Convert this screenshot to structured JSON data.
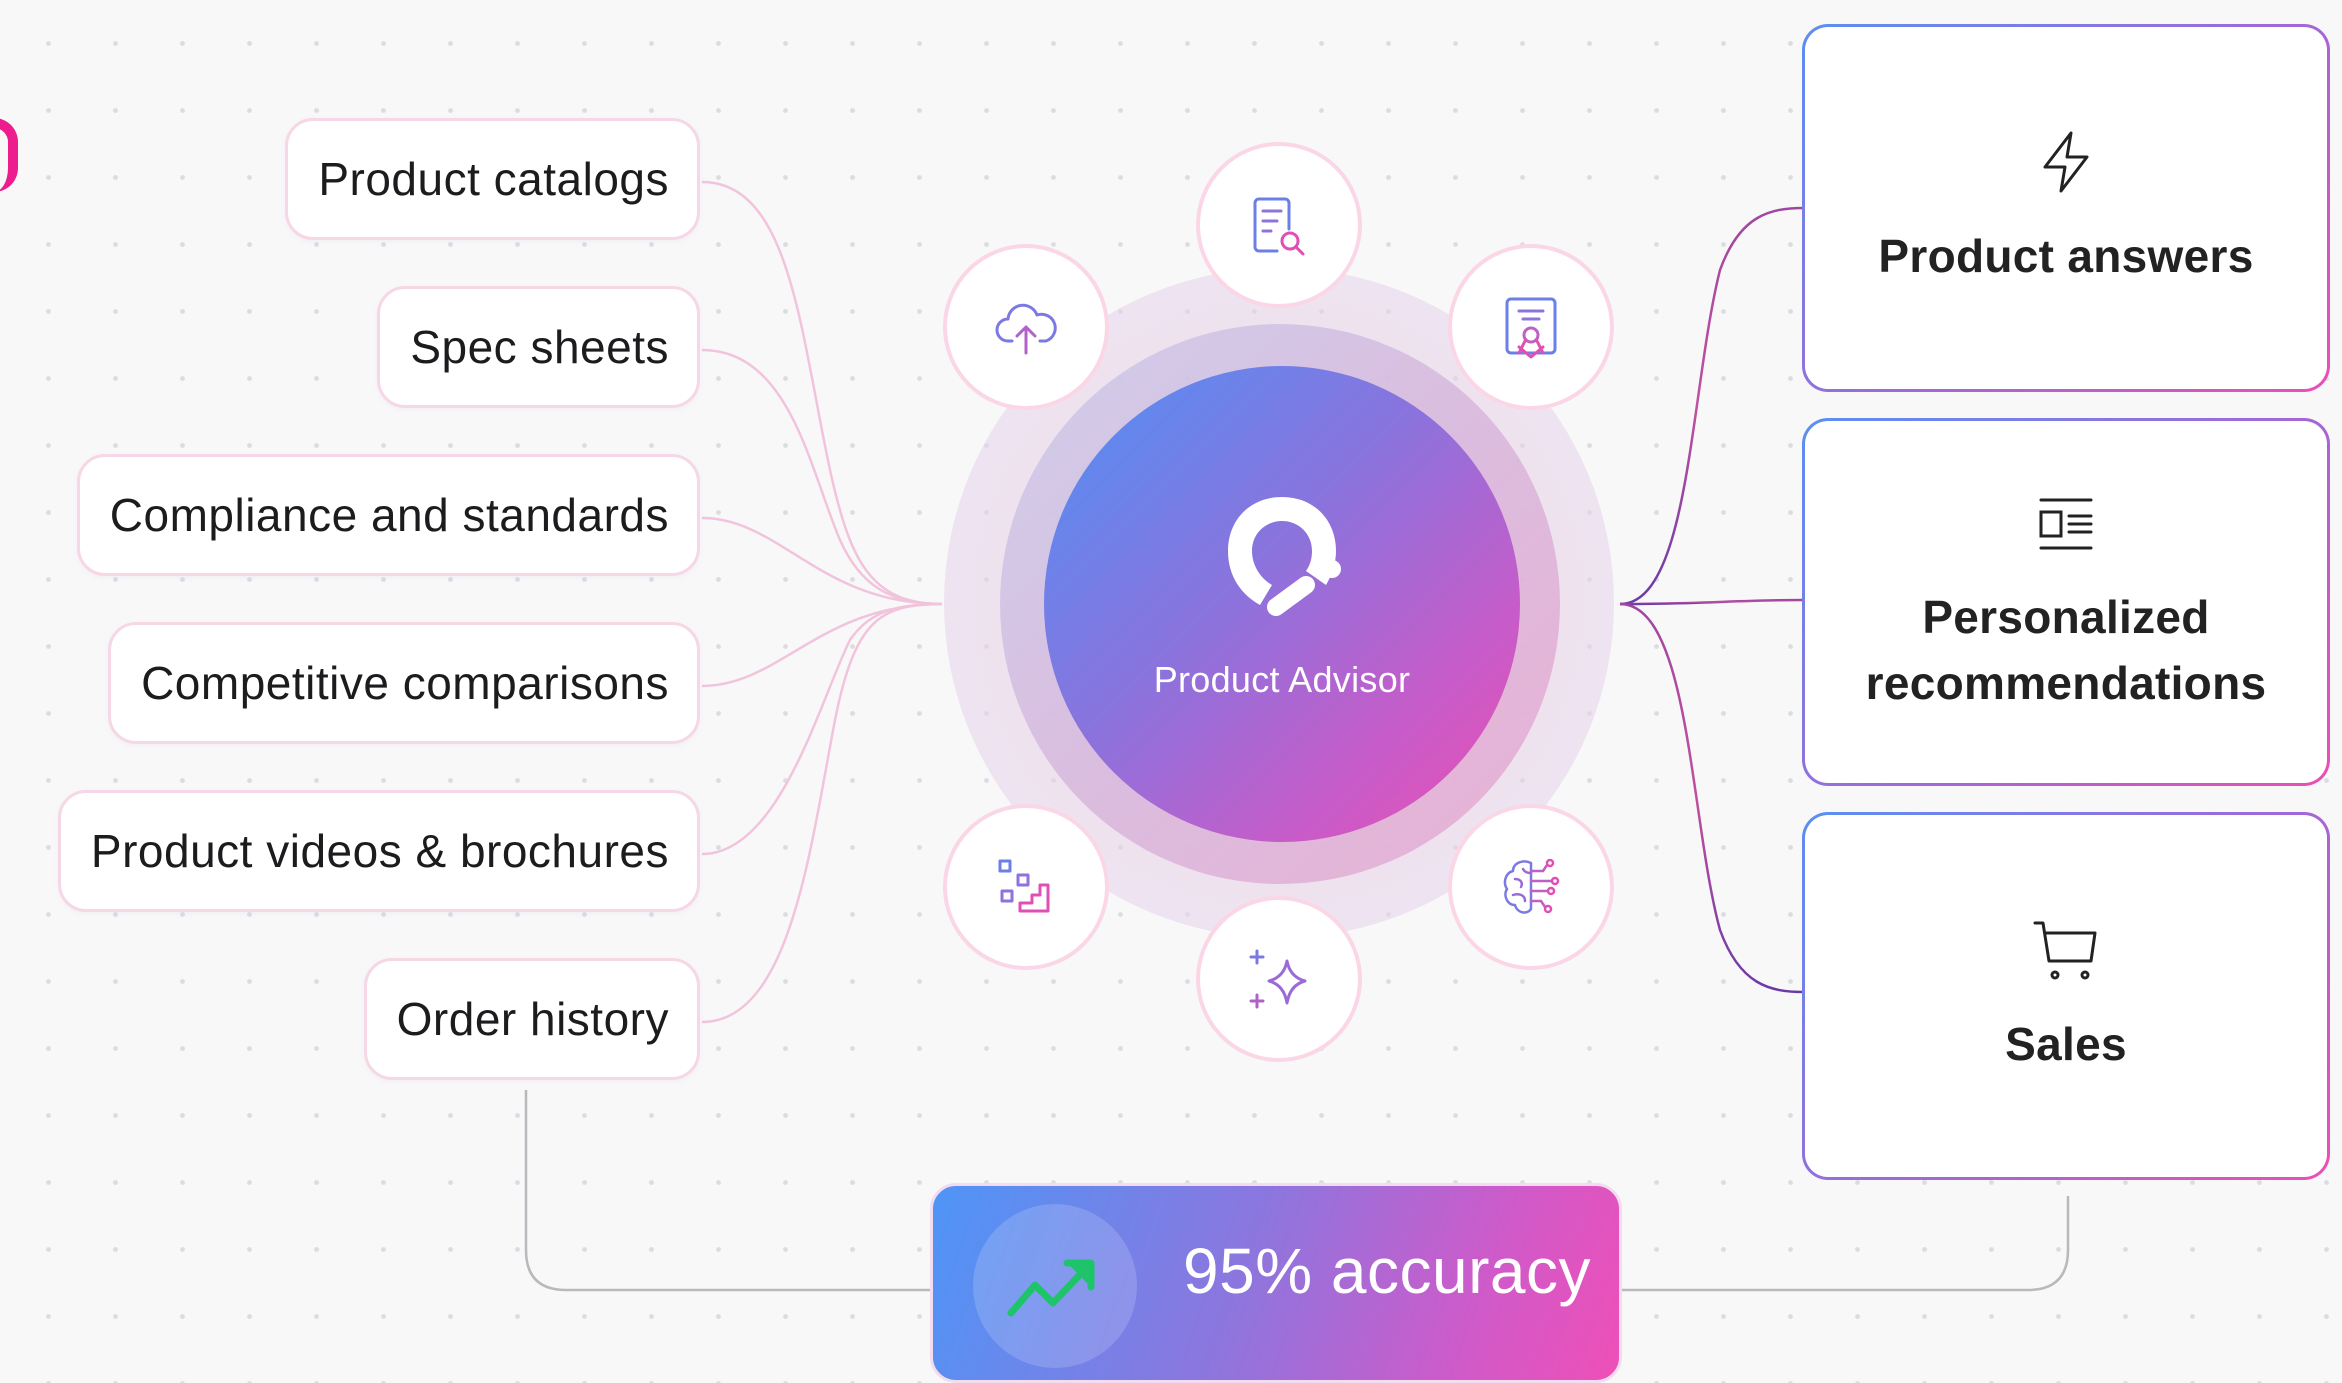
{
  "sources": [
    {
      "label": "Product catalogs"
    },
    {
      "label": "Spec sheets"
    },
    {
      "label": "Compliance and standards"
    },
    {
      "label": "Competitive comparisons"
    },
    {
      "label": "Product videos & brochures"
    },
    {
      "label": "Order history"
    }
  ],
  "hub": {
    "label": "Product Advisor",
    "satellite_icons": [
      "document-search-icon",
      "certificate-icon",
      "cloud-upload-icon",
      "steps-icon",
      "sparkle-icon",
      "brain-circuit-icon"
    ]
  },
  "outputs": [
    {
      "label": "Product answers",
      "icon": "lightning-icon"
    },
    {
      "label": "Personalized recommendations",
      "icon": "layout-list-icon"
    },
    {
      "label": "Sales",
      "icon": "cart-icon"
    }
  ],
  "accuracy": {
    "label": "95% accuracy",
    "icon": "trend-up-icon"
  },
  "colors": {
    "pill_border": "#f6d7e6",
    "gradient_blue": "#4f91f5",
    "gradient_pink": "#ee4eb3",
    "connector_left": "#f1c4dc",
    "connector_right": "#a44ea4",
    "trend_green": "#1fc46a"
  }
}
